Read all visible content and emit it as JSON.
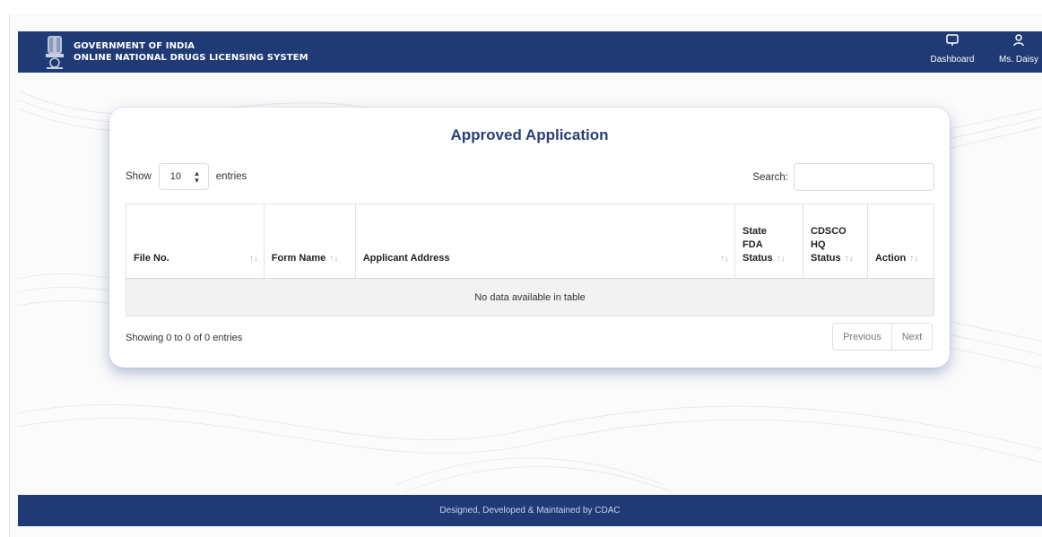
{
  "header": {
    "line1": "GOVERNMENT OF INDIA",
    "line2": "ONLINE NATIONAL DRUGS LICENSING SYSTEM",
    "nav": [
      {
        "label": "Dashboard",
        "icon": "monitor-icon"
      },
      {
        "label": "Ms. Daisy",
        "icon": "user-icon"
      }
    ],
    "bar_color": "#1f3a74"
  },
  "card": {
    "title": "Approved Application",
    "show_label": "Show",
    "page_length": "10",
    "entries_label": "entries",
    "search_label": "Search:",
    "search_value": "",
    "columns": [
      {
        "lines": [
          "File No."
        ]
      },
      {
        "lines": [
          "Form Name"
        ]
      },
      {
        "lines": [
          "Applicant Address"
        ]
      },
      {
        "lines": [
          "State",
          "FDA",
          "Status"
        ]
      },
      {
        "lines": [
          "CDSCO",
          "HQ",
          "Status"
        ]
      },
      {
        "lines": [
          "Action"
        ]
      }
    ],
    "empty_message": "No data available in table",
    "info": "Showing 0 to 0 of 0 entries",
    "pager": {
      "previous": "Previous",
      "next": "Next"
    }
  },
  "footer": {
    "text": "Designed, Developed & Maintained by CDAC"
  }
}
